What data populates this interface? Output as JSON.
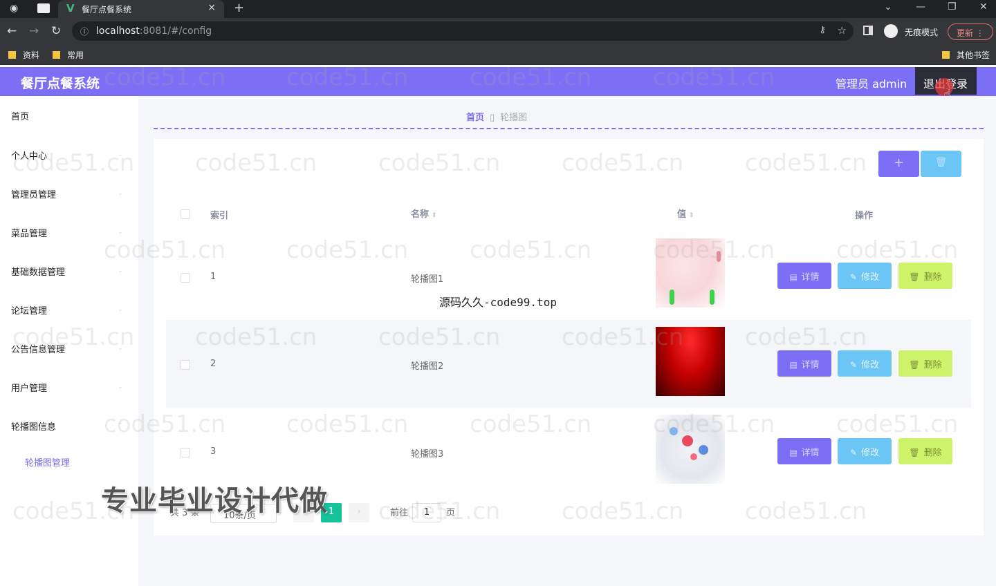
{
  "browser": {
    "tab_title": "餐厅点餐系统",
    "tab_close": "×",
    "new_tab": "+",
    "url_host": "localhost",
    "url_rest": ":8081/#/config",
    "incognito_label": "无痕模式",
    "update_label": "更新",
    "bookmarks": [
      "资料",
      "常用"
    ],
    "other_bookmarks": "其他书签"
  },
  "header": {
    "title": "餐厅点餐系统",
    "user_label": "管理员 admin",
    "logout_label": "退出登录"
  },
  "sidebar": {
    "items": [
      "首页",
      "个人中心",
      "管理员管理",
      "菜品管理",
      "基础数据管理",
      "论坛管理",
      "公告信息管理",
      "用户管理",
      "轮播图信息"
    ],
    "sub_item": "轮播图管理"
  },
  "breadcrumb": {
    "home": "首页",
    "current": "轮播图"
  },
  "toolbar": {
    "add_icon": "+",
    "delete_icon": "🗑"
  },
  "table": {
    "headers": {
      "index": "索引",
      "name": "名称",
      "value": "值",
      "actions": "操作"
    },
    "rows": [
      {
        "index": "1",
        "name": "轮播图1"
      },
      {
        "index": "2",
        "name": "轮播图2"
      },
      {
        "index": "3",
        "name": "轮播图3"
      }
    ],
    "action_labels": {
      "detail": "详情",
      "edit": "修改",
      "delete": "删除"
    }
  },
  "pagination": {
    "total": "共 3 条",
    "page_size": "10条/页",
    "current_page": "1",
    "goto_prefix": "前往",
    "goto_value": "1",
    "goto_suffix": "页"
  },
  "overlays": {
    "watermark": "code51.cn",
    "source_text": "源码久久-code99.top",
    "banner": "专业毕业设计代做"
  },
  "colors": {
    "primary": "#7b6ff5",
    "info": "#6cc6f5",
    "warning_lime": "#cdf36b",
    "success": "#15c39a"
  }
}
